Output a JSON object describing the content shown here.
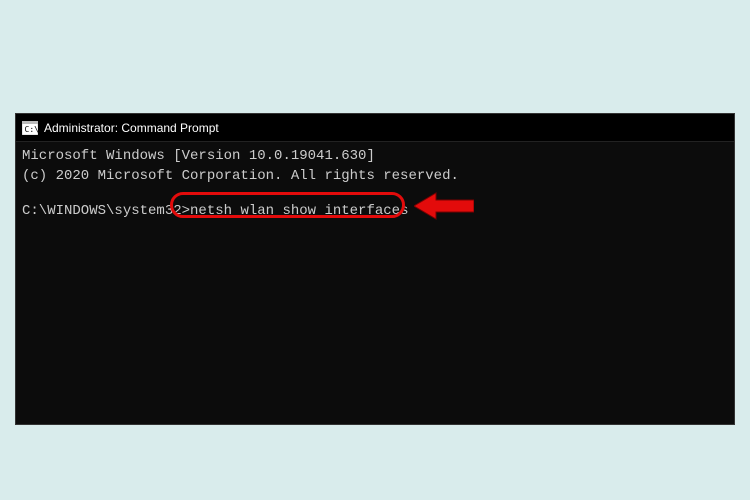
{
  "window": {
    "title": "Administrator: Command Prompt"
  },
  "terminal": {
    "line1": "Microsoft Windows [Version 10.0.19041.630]",
    "line2": "(c) 2020 Microsoft Corporation. All rights reserved.",
    "prompt_path": "C:\\WINDOWS\\system32>",
    "command": "netsh wlan show interfaces"
  },
  "colors": {
    "annotation_red": "#e30b0b"
  }
}
